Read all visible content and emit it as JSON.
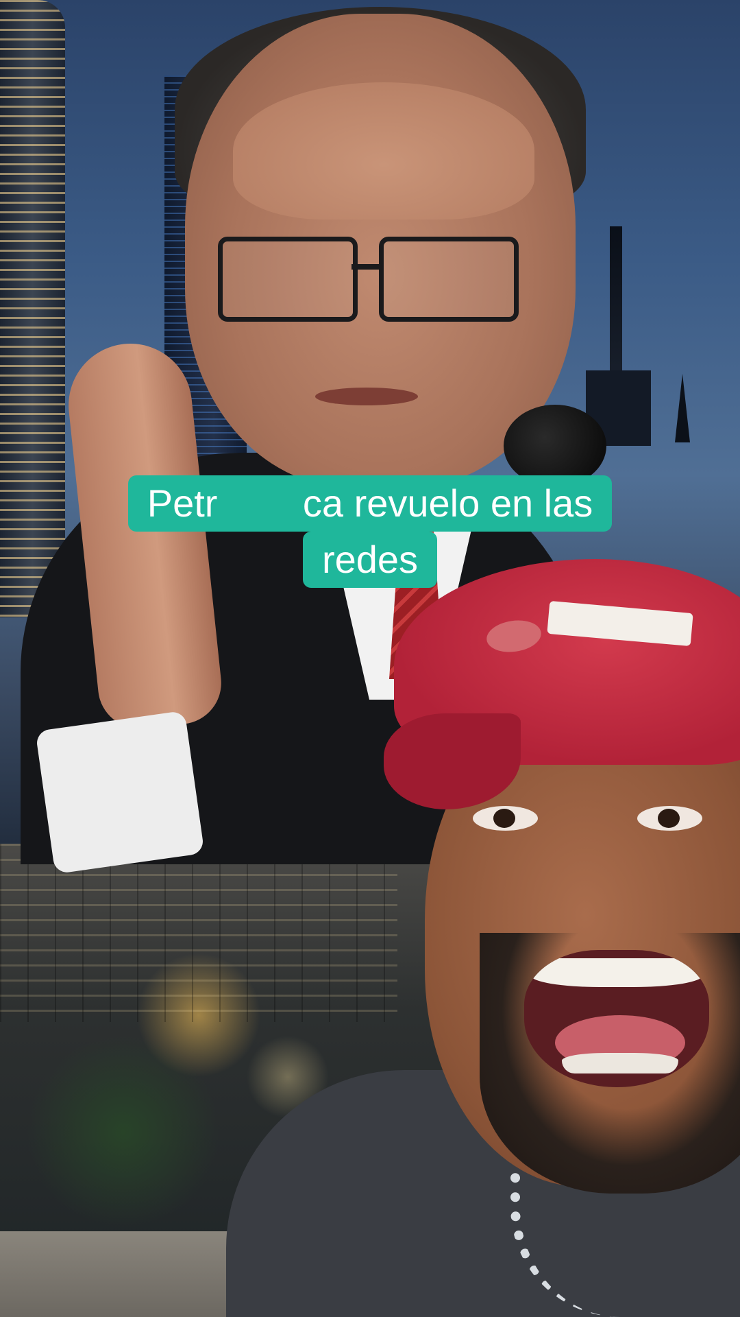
{
  "caption": {
    "line1": "Petr        ca revuelo en las",
    "line2": "redes",
    "bg_color": "#1fb79b",
    "text_color": "#ffffff"
  }
}
